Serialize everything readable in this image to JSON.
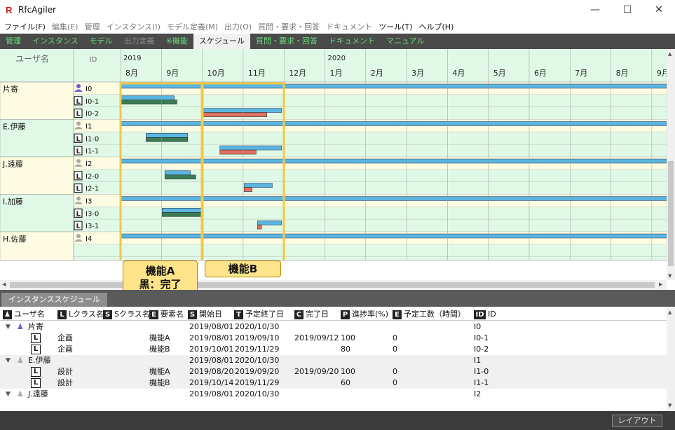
{
  "app": {
    "title": "RfcAgiler"
  },
  "window": {
    "minimize": "—",
    "maximize": "☐",
    "close": "✕"
  },
  "menu": [
    {
      "label": "ファイル(F)",
      "dim": false
    },
    {
      "label": "編集(E)",
      "dim": true
    },
    {
      "label": "管理",
      "dim": true
    },
    {
      "label": "インスタンス(I)",
      "dim": true
    },
    {
      "label": "モデル定義(M)",
      "dim": true
    },
    {
      "label": "出力(O)",
      "dim": true
    },
    {
      "label": "質問・要求・回答",
      "dim": true
    },
    {
      "label": "ドキュメント",
      "dim": true
    },
    {
      "label": "ツール(T)",
      "dim": false
    },
    {
      "label": "ヘルプ(H)",
      "dim": false
    }
  ],
  "tabs": [
    {
      "label": "管理",
      "state": "green"
    },
    {
      "label": "インスタンス",
      "state": "green"
    },
    {
      "label": "モデル",
      "state": "green"
    },
    {
      "label": "出力定義",
      "state": "dim"
    },
    {
      "label": "※機能",
      "state": "green"
    },
    {
      "label": "スケジュール",
      "state": "active"
    },
    {
      "label": "質問・要求・回答",
      "state": "green"
    },
    {
      "label": "ドキュメント",
      "state": "green"
    },
    {
      "label": "マニュアル",
      "state": "green"
    }
  ],
  "gantt": {
    "header": {
      "user": "ユーザ名",
      "id": "ID"
    },
    "years": [
      {
        "label": "2019",
        "month_index": 0
      },
      {
        "label": "2020",
        "month_index": 5
      }
    ],
    "months": [
      "8月",
      "9月",
      "10月",
      "11月",
      "12月",
      "1月",
      "2月",
      "3月",
      "4月",
      "5月",
      "6月",
      "7月",
      "8月",
      "9月"
    ],
    "timeline_start": "2019-08-01",
    "groups": [
      {
        "user": "片寄",
        "rows": [
          {
            "id": "I0",
            "kind": "user",
            "active": true,
            "planned": [
              "2019-08-01",
              "2020-10-30"
            ]
          },
          {
            "id": "I0-1",
            "kind": "L",
            "planned": [
              "2019-08-01",
              "2019-09-10"
            ],
            "actual": [
              "2019-08-01",
              "2019-09-12"
            ],
            "status": "done"
          },
          {
            "id": "I0-2",
            "kind": "L",
            "planned": [
              "2019-10-01",
              "2019-11-29"
            ],
            "actual": [
              "2019-10-01",
              "2019-11-18"
            ],
            "status": "progress"
          }
        ]
      },
      {
        "user": "E.伊藤",
        "rows": [
          {
            "id": "I1",
            "kind": "user",
            "active": false,
            "planned": [
              "2019-08-01",
              "2020-10-30"
            ]
          },
          {
            "id": "I1-0",
            "kind": "L",
            "planned": [
              "2019-08-20",
              "2019-09-20"
            ],
            "actual": [
              "2019-08-20",
              "2019-09-20"
            ],
            "status": "done"
          },
          {
            "id": "I1-1",
            "kind": "L",
            "planned": [
              "2019-10-14",
              "2019-11-29"
            ],
            "actual": [
              "2019-10-14",
              "2019-11-10"
            ],
            "status": "progress"
          }
        ]
      },
      {
        "user": "J.遠藤",
        "rows": [
          {
            "id": "I2",
            "kind": "user",
            "active": false,
            "planned": [
              "2019-08-01",
              "2020-10-30"
            ]
          },
          {
            "id": "I2-0",
            "kind": "L",
            "planned": [
              "2019-09-03",
              "2019-09-22"
            ],
            "actual": [
              "2019-09-03",
              "2019-09-26"
            ],
            "status": "done"
          },
          {
            "id": "I2-1",
            "kind": "L",
            "planned": [
              "2019-11-01",
              "2019-11-22"
            ],
            "actual": [
              "2019-11-01",
              "2019-11-07"
            ],
            "status": "progress"
          }
        ]
      },
      {
        "user": "I.加藤",
        "rows": [
          {
            "id": "I3",
            "kind": "user",
            "active": false,
            "planned": [
              "2019-08-01",
              "2020-10-30"
            ]
          },
          {
            "id": "I3-0",
            "kind": "L",
            "planned": [
              "2019-09-01",
              "2019-09-30"
            ],
            "actual": [
              "2019-09-01",
              "2019-09-30"
            ],
            "status": "done"
          },
          {
            "id": "I3-1",
            "kind": "L",
            "planned": [
              "2019-11-11",
              "2019-11-29"
            ],
            "actual": [
              "2019-11-11",
              "2019-11-14"
            ],
            "status": "progress"
          }
        ]
      },
      {
        "user": "H.佐藤",
        "rows": [
          {
            "id": "I4",
            "kind": "user",
            "active": false,
            "planned": [
              "2019-08-01",
              "2020-10-30"
            ]
          }
        ]
      }
    ],
    "colors": {
      "bg_even": "#dff9e6",
      "bg_odd": "#fdfce2",
      "plan": "#5ab6e0",
      "done": "#3c7a56",
      "progress": "#e07060",
      "highlight": "#f4c842"
    }
  },
  "callouts": [
    {
      "line1": "機能A",
      "line2": "黒：完了"
    },
    {
      "line1": "機能B"
    }
  ],
  "bottom_tab": "インスタンススケジュール",
  "table": {
    "columns": [
      {
        "badge": "",
        "label": "ユーザ名",
        "icon": "user"
      },
      {
        "badge": "L",
        "label": "Lクラス名"
      },
      {
        "badge": "S",
        "label": "Sクラス名"
      },
      {
        "badge": "E",
        "label": "要素名"
      },
      {
        "badge": "S",
        "label": "開始日"
      },
      {
        "badge": "T",
        "label": "予定終了日"
      },
      {
        "badge": "C",
        "label": "完了日"
      },
      {
        "badge": "P",
        "label": "進捗率(%)"
      },
      {
        "badge": "E",
        "label": "予定工数（時間）"
      },
      {
        "badge": "ID",
        "label": "ID"
      }
    ],
    "rows": [
      {
        "type": "user",
        "user": "片寄",
        "active": true,
        "start": "2019/08/01",
        "end": "2020/10/30",
        "id": "I0"
      },
      {
        "type": "L",
        "lclass": "企画",
        "element": "機能A",
        "start": "2019/08/01",
        "end": "2019/09/10",
        "done": "2019/09/12",
        "progress": "100",
        "effort": "0",
        "id": "I0-1"
      },
      {
        "type": "L",
        "lclass": "企画",
        "element": "機能B",
        "start": "2019/10/01",
        "end": "2019/11/29",
        "done": "",
        "progress": "80",
        "effort": "0",
        "id": "I0-2"
      },
      {
        "type": "user",
        "user": "E.伊藤",
        "active": false,
        "start": "2019/08/01",
        "end": "2020/10/30",
        "id": "I1"
      },
      {
        "type": "L",
        "lclass": "設計",
        "element": "機能A",
        "start": "2019/08/20",
        "end": "2019/09/20",
        "done": "2019/09/20",
        "progress": "100",
        "effort": "0",
        "id": "I1-0"
      },
      {
        "type": "L",
        "lclass": "設計",
        "element": "機能B",
        "start": "2019/10/14",
        "end": "2019/11/29",
        "done": "",
        "progress": "60",
        "effort": "0",
        "id": "I1-1"
      },
      {
        "type": "user",
        "user": "J.遠藤",
        "active": false,
        "start": "2019/08/01",
        "end": "2020/10/30",
        "id": "I2"
      }
    ]
  },
  "status": {
    "layout_button": "レイアウト"
  }
}
